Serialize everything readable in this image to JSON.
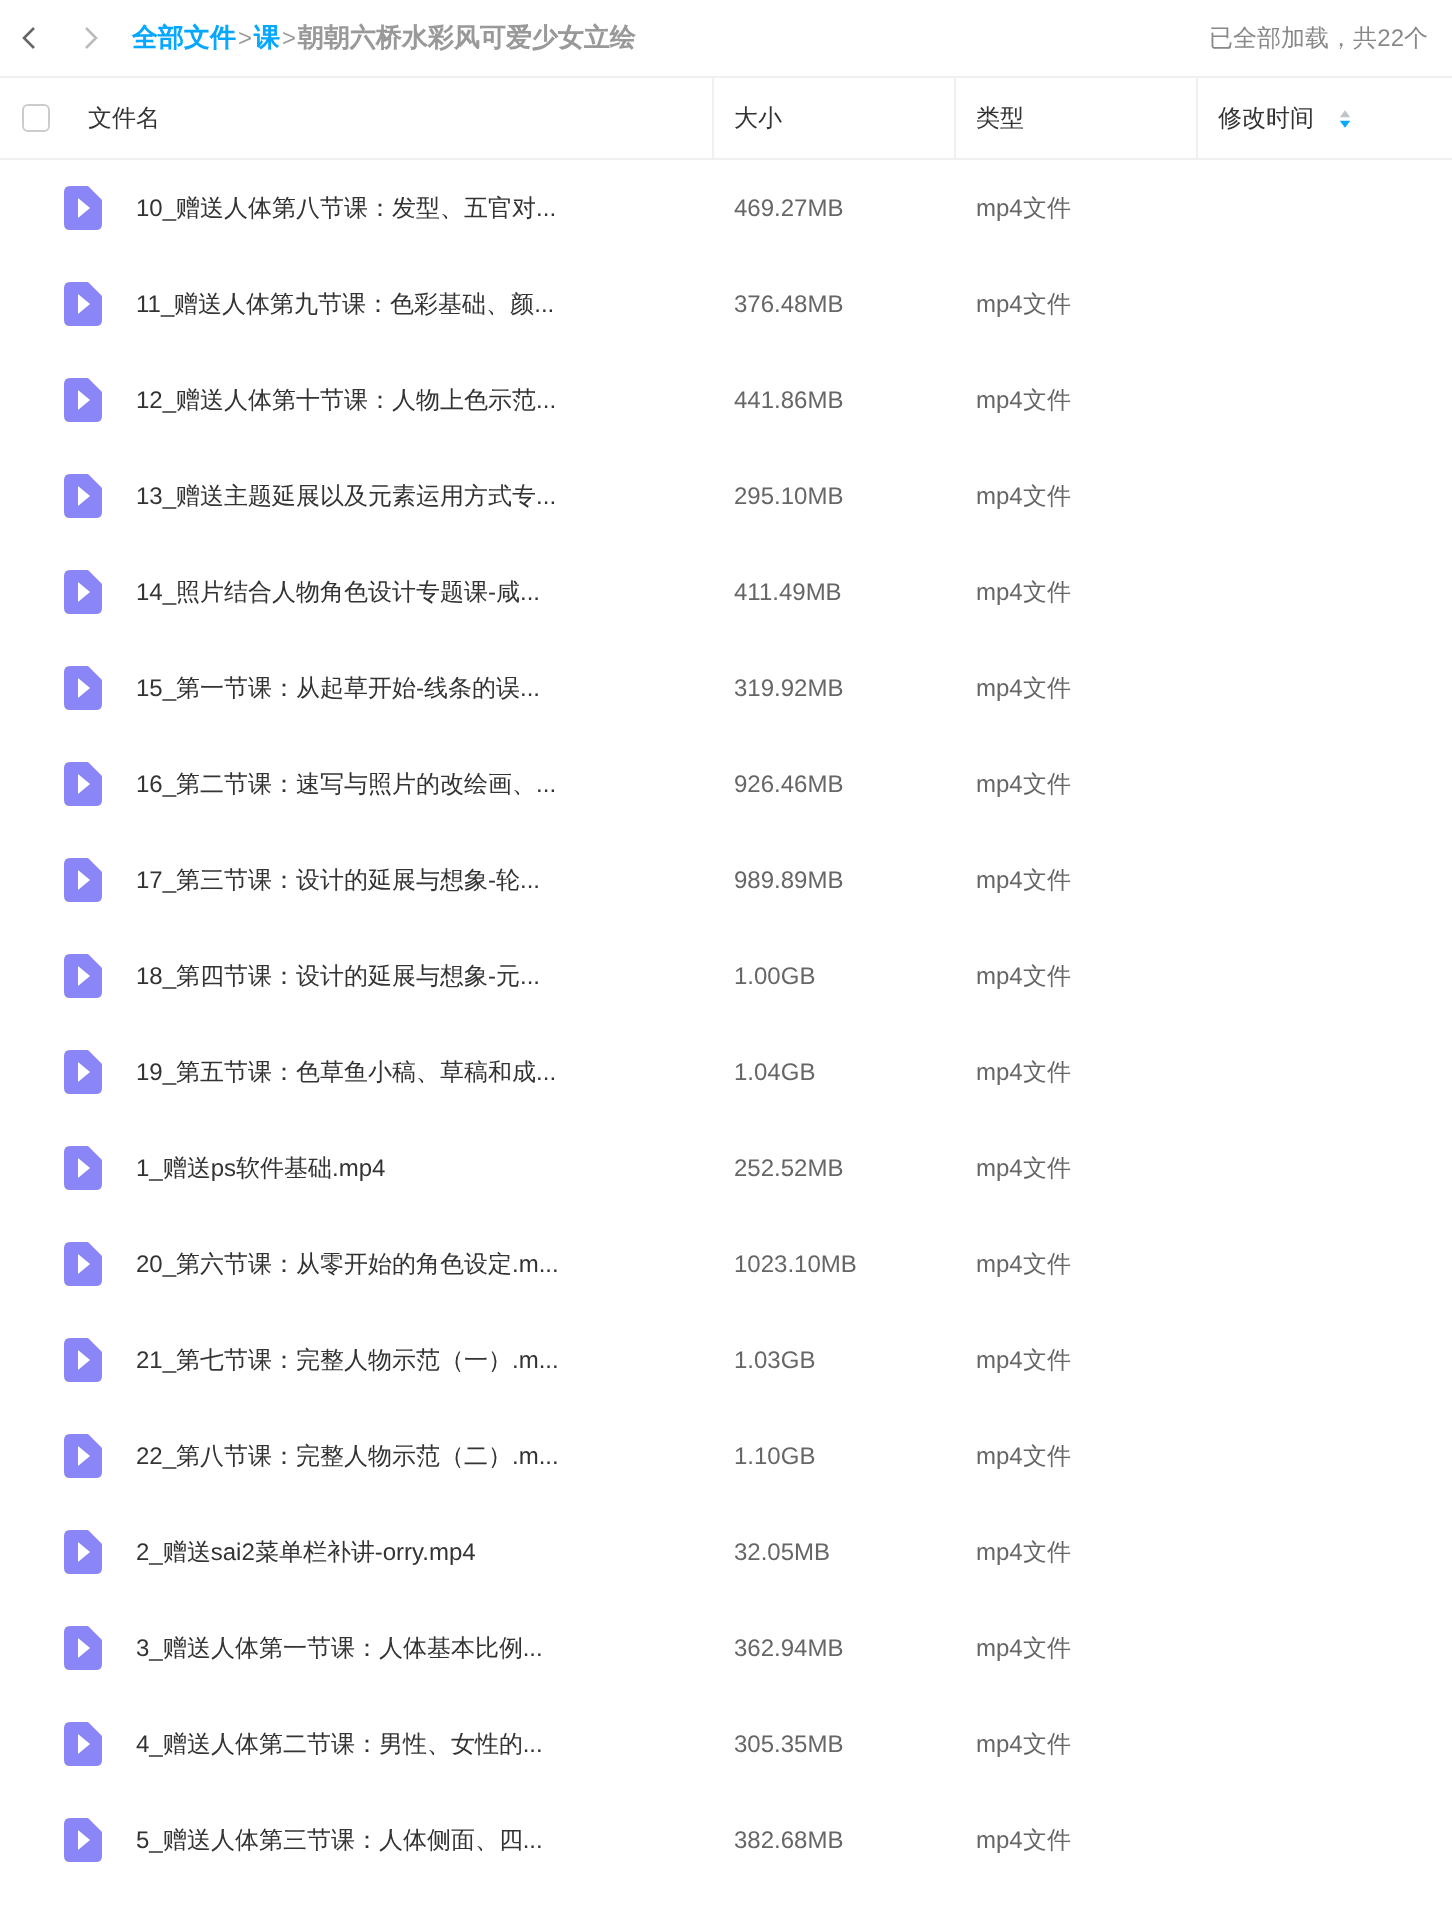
{
  "toolbar": {
    "breadcrumb": [
      {
        "label": "全部文件",
        "current": false
      },
      {
        "label": "课",
        "current": false
      },
      {
        "label": "朝朝六桥水彩风可爱少女立绘",
        "current": true
      }
    ],
    "separator": ">",
    "status": "已全部加载，共22个"
  },
  "table": {
    "select_all": {
      "checked": false
    },
    "columns": [
      {
        "label": "文件名"
      },
      {
        "label": "大小"
      },
      {
        "label": "类型"
      },
      {
        "label": "修改时间"
      }
    ],
    "rows": [
      {
        "name": "10_赠送人体第八节课：发型、五官对...",
        "size": "469.27MB",
        "type": "mp4文件"
      },
      {
        "name": "11_赠送人体第九节课：色彩基础、颜...",
        "size": "376.48MB",
        "type": "mp4文件"
      },
      {
        "name": "12_赠送人体第十节课：人物上色示范...",
        "size": "441.86MB",
        "type": "mp4文件"
      },
      {
        "name": "13_赠送主题延展以及元素运用方式专...",
        "size": "295.10MB",
        "type": "mp4文件"
      },
      {
        "name": "14_照片结合人物角色设计专题课-咸...",
        "size": "411.49MB",
        "type": "mp4文件"
      },
      {
        "name": "15_第一节课：从起草开始-线条的误...",
        "size": "319.92MB",
        "type": "mp4文件"
      },
      {
        "name": "16_第二节课：速写与照片的改绘画、...",
        "size": "926.46MB",
        "type": "mp4文件"
      },
      {
        "name": "17_第三节课：设计的延展与想象-轮...",
        "size": "989.89MB",
        "type": "mp4文件"
      },
      {
        "name": "18_第四节课：设计的延展与想象-元...",
        "size": "1.00GB",
        "type": "mp4文件"
      },
      {
        "name": "19_第五节课：色草鱼小稿、草稿和成...",
        "size": "1.04GB",
        "type": "mp4文件"
      },
      {
        "name": "1_赠送ps软件基础.mp4",
        "size": "252.52MB",
        "type": "mp4文件"
      },
      {
        "name": "20_第六节课：从零开始的角色设定.m...",
        "size": "1023.10MB",
        "type": "mp4文件"
      },
      {
        "name": "21_第七节课：完整人物示范（一）.m...",
        "size": "1.03GB",
        "type": "mp4文件"
      },
      {
        "name": "22_第八节课：完整人物示范（二）.m...",
        "size": "1.10GB",
        "type": "mp4文件"
      },
      {
        "name": "2_赠送sai2菜单栏补讲-orry.mp4",
        "size": "32.05MB",
        "type": "mp4文件"
      },
      {
        "name": "3_赠送人体第一节课：人体基本比例...",
        "size": "362.94MB",
        "type": "mp4文件"
      },
      {
        "name": "4_赠送人体第二节课：男性、女性的...",
        "size": "305.35MB",
        "type": "mp4文件"
      },
      {
        "name": "5_赠送人体第三节课：人体侧面、四...",
        "size": "382.68MB",
        "type": "mp4文件"
      }
    ]
  }
}
